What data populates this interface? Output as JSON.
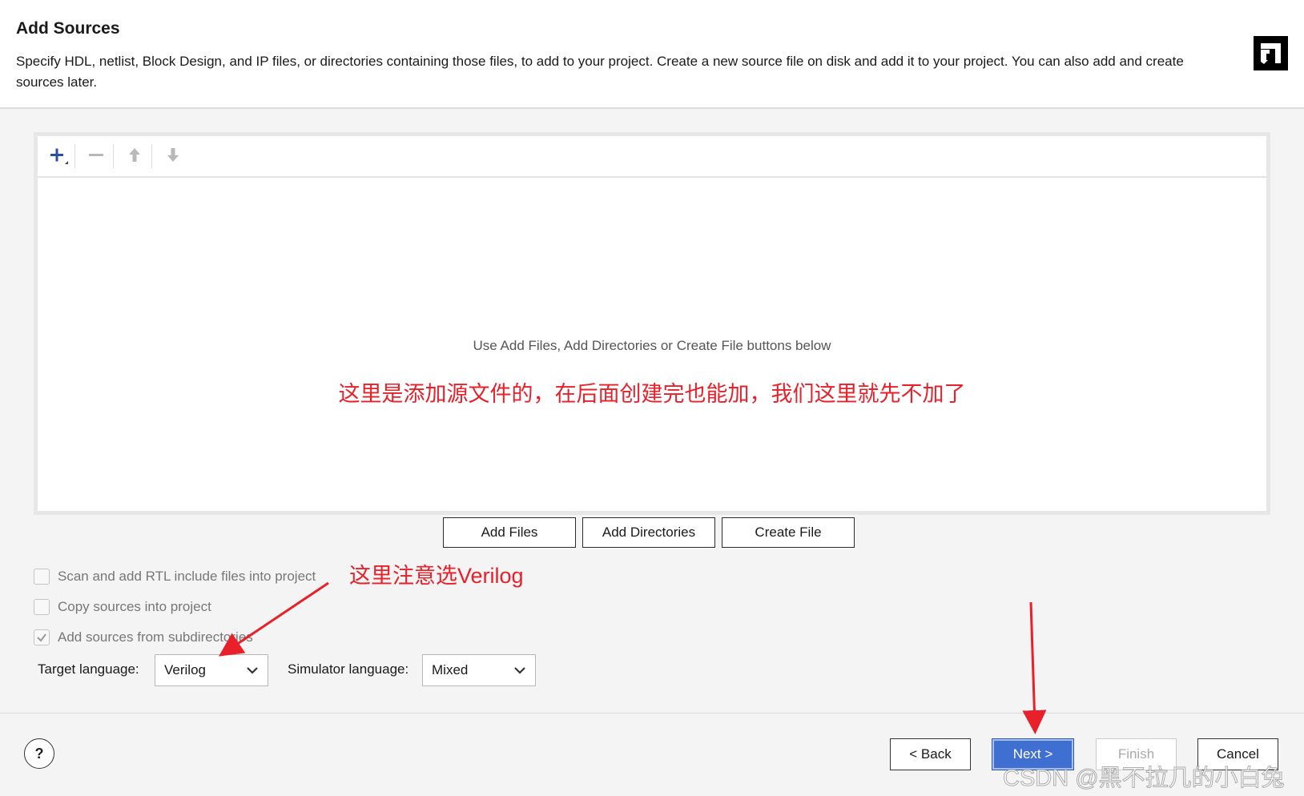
{
  "header": {
    "title": "Add Sources",
    "description": "Specify HDL, netlist, Block Design, and IP files, or directories containing those files, to add to your project. Create a new source file on disk and add it to your project. You can also add and create sources later.",
    "logo_icon": "amd-logo-icon"
  },
  "toolbar": {
    "icons": [
      "plus-icon",
      "minus-icon",
      "arrow-up-icon",
      "arrow-down-icon"
    ]
  },
  "file_list": {
    "hint": "Use Add Files, Add Directories or Create File buttons below",
    "annotation": "这里是添加源文件的，在后面创建完也能加，我们这里就先不加了"
  },
  "buttons": {
    "add_files": "Add Files",
    "add_directories": "Add Directories",
    "create_file": "Create File"
  },
  "options": {
    "scan_rtl": {
      "label": "Scan and add RTL include files into project",
      "checked": false
    },
    "copy_sources": {
      "label": "Copy sources into project",
      "checked": false
    },
    "add_subdirs": {
      "label": "Add sources from subdirectories",
      "checked": true
    }
  },
  "language": {
    "target_label": "Target language:",
    "target_value": "Verilog",
    "simulator_label": "Simulator language:",
    "simulator_value": "Mixed",
    "annotation": "这里注意选Verilog"
  },
  "footer": {
    "help": "?",
    "back": "< Back",
    "next": "Next >",
    "finish": "Finish",
    "cancel": "Cancel"
  },
  "watermark": "CSDN @黑不拉几的小白兔",
  "colors": {
    "annotation_red": "#e8202a",
    "primary_blue": "#3f6fd1",
    "toolbar_blue": "#2a4fa0"
  }
}
